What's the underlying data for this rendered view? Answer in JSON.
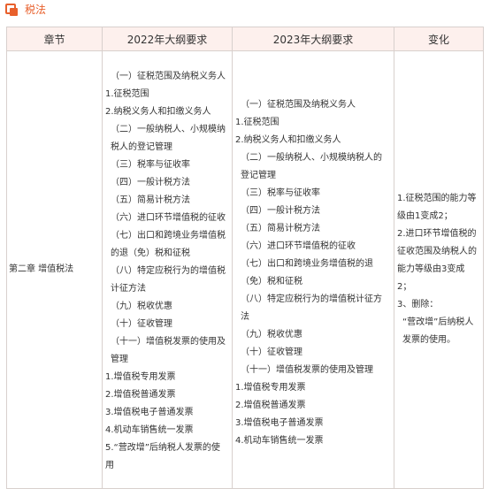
{
  "header": {
    "title": "税法",
    "icon": "orange-square-icon",
    "accent_color": "#e8602c"
  },
  "table": {
    "columns": [
      "章节",
      "2022年大纲要求",
      "2023年大纲要求",
      "变化"
    ],
    "chapter": "第二章 增值税法",
    "req_2022": [
      "（一）征税范围及纳税义务人",
      "1.征税范围",
      "2.纳税义务人和扣缴义务人",
      "（二）一般纳税人、小规模纳税人的登记管理",
      "（三）税率与征收率",
      "（四）一般计税方法",
      "（五）简易计税方法",
      "（六）进口环节增值税的征收",
      "（七）出口和跨境业务增值税的退（免）税和征税",
      "（八）特定应税行为的增值税计征方法",
      "（九）税收优惠",
      "（十）征收管理",
      "（十一）增值税发票的使用及管理",
      "1.增值税专用发票",
      "2.增值税普通发票",
      "3.增值税电子普通发票",
      "4.机动车销售统一发票",
      "5.“营改增”后纳税人发票的使用"
    ],
    "req_2023": [
      "（一）征税范围及纳税义务人",
      "1.征税范围",
      "2.纳税义务人和扣缴义务人",
      "（二）一般纳税人、小规模纳税人的登记管理",
      "（三）税率与征收率",
      "（四）一般计税方法",
      "（五）简易计税方法",
      "（六）进口环节增值税的征收",
      "（七）出口和跨境业务增值税的退（免）税和征税",
      "（八）特定应税行为的增值税计征方法",
      "（九）税收优惠",
      "（十）征收管理",
      "（十一）增值税发票的使用及管理",
      "1.增值税专用发票",
      "2.增值税普通发票",
      "3.增值税电子普通发票",
      "4.机动车销售统一发票"
    ],
    "changes": [
      "1.征税范围的能力等级由1变成2；",
      "2.进口环节增值税的征收范围及纳税人的能力等级由3变成2；",
      "3、删除：",
      "“营改增”后纳税人发票的使用。"
    ]
  }
}
